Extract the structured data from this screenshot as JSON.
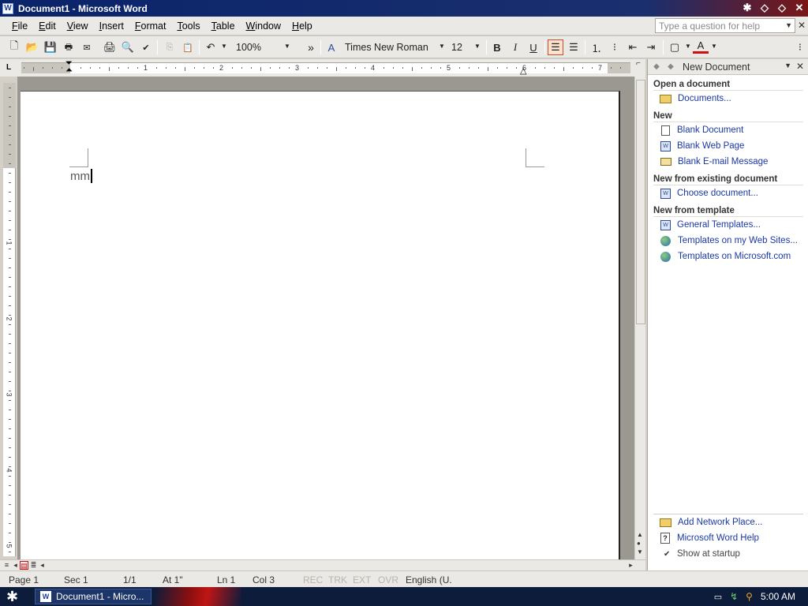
{
  "window": {
    "title": "Document1 - Microsoft Word",
    "app_icon": "W"
  },
  "menu": {
    "items": [
      "File",
      "Edit",
      "View",
      "Insert",
      "Format",
      "Tools",
      "Table",
      "Window",
      "Help"
    ],
    "help_placeholder": "Type a question for help"
  },
  "toolbar": {
    "zoom": "100%",
    "font_name": "Times New Roman",
    "font_size": "12",
    "bold": "B",
    "italic": "I",
    "underline": "U",
    "font_color_label": "A",
    "more": "»"
  },
  "ruler": {
    "numbers": [
      "1",
      "2",
      "3",
      "4",
      "5",
      "6",
      "7"
    ],
    "vertical_numbers": [
      "1",
      "2",
      "3",
      "4",
      "5"
    ],
    "tab_selector": "L"
  },
  "document": {
    "text": "mm"
  },
  "task_pane": {
    "title": "New Document",
    "sections": {
      "open": "Open a document",
      "new": "New",
      "existing": "New from existing document",
      "template": "New from template"
    },
    "items": {
      "documents": "Documents...",
      "blank_document": "Blank Document",
      "blank_web_page": "Blank Web Page",
      "blank_email": "Blank E-mail Message",
      "choose_document": "Choose document...",
      "general_templates": "General Templates...",
      "templates_web_sites": "Templates on my Web Sites...",
      "templates_microsoft": "Templates on Microsoft.com",
      "add_network_place": "Add Network Place...",
      "word_help": "Microsoft Word Help"
    },
    "show_at_startup": "Show at startup",
    "show_at_startup_checked": true
  },
  "status": {
    "page": "Page 1",
    "sec": "Sec 1",
    "page_of": "1/1",
    "at": "At 1\"",
    "ln": "Ln 1",
    "col": "Col 3",
    "rec": "REC",
    "trk": "TRK",
    "ext": "EXT",
    "ovr": "OVR",
    "language": "English (U."
  },
  "taskbar": {
    "task_label": "Document1 - Micro...",
    "time": "5:00 AM"
  },
  "colors": {
    "titlebar": "#0a246a",
    "link": "#1a37a6",
    "font_color_underline": "#d01010",
    "taskbar": "#0d1c3a"
  }
}
